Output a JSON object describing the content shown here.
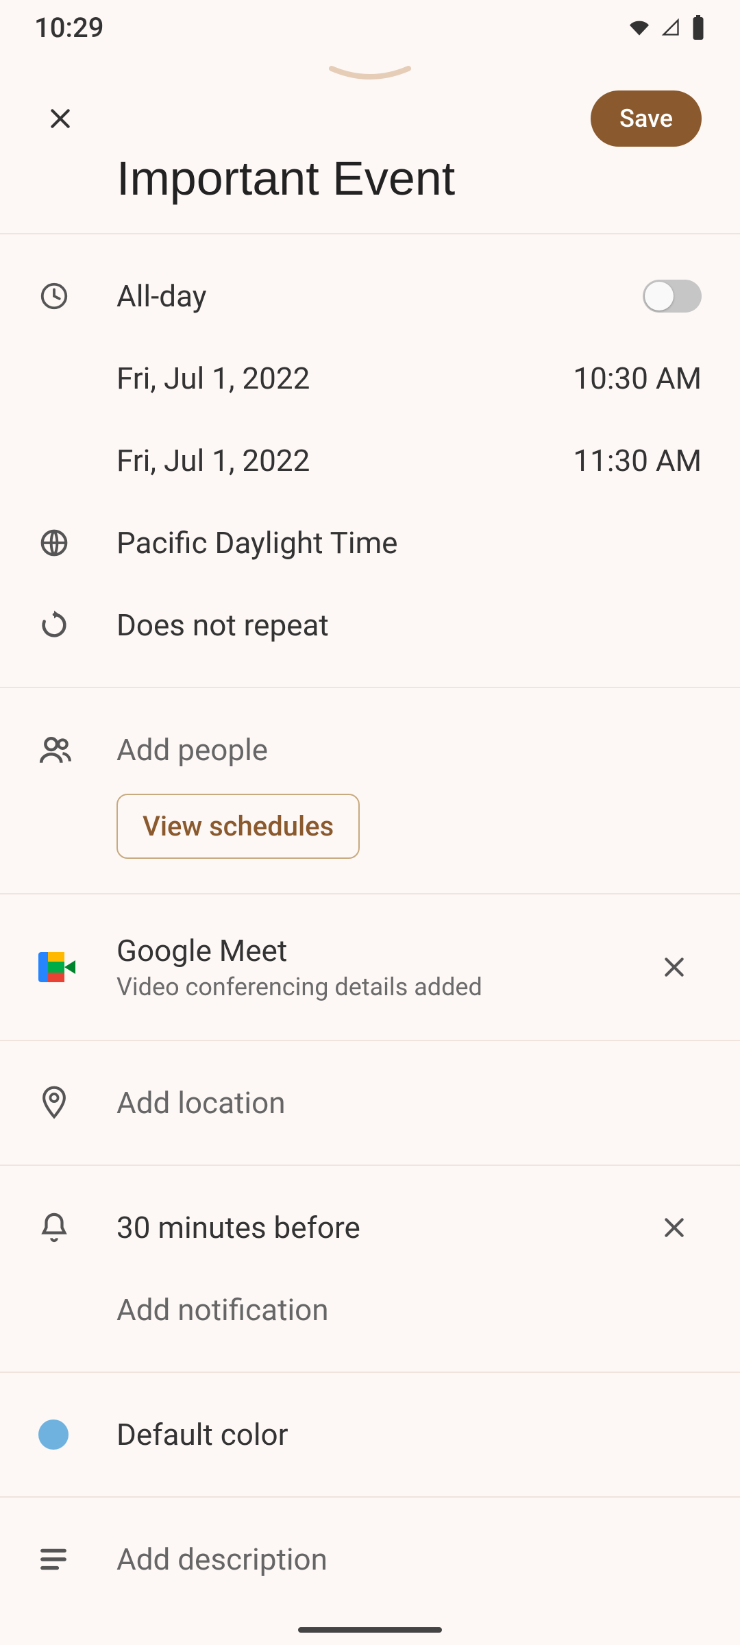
{
  "status": {
    "time": "10:29"
  },
  "header": {
    "save_label": "Save",
    "title": "Important Event"
  },
  "allday": {
    "label": "All-day",
    "on": false
  },
  "start": {
    "date": "Fri, Jul 1, 2022",
    "time": "10:30 AM"
  },
  "end": {
    "date": "Fri, Jul 1, 2022",
    "time": "11:30 AM"
  },
  "timezone": {
    "label": "Pacific Daylight Time"
  },
  "repeat": {
    "label": "Does not repeat"
  },
  "people": {
    "add_label": "Add people",
    "view_schedules_label": "View schedules"
  },
  "conference": {
    "provider": "Google Meet",
    "subtext": "Video conferencing details added"
  },
  "location": {
    "placeholder": "Add location"
  },
  "notifications": {
    "items": [
      "30 minutes before"
    ],
    "add_label": "Add notification"
  },
  "color": {
    "label": "Default color",
    "hex": "#6fb2e0"
  },
  "description": {
    "placeholder": "Add description"
  }
}
